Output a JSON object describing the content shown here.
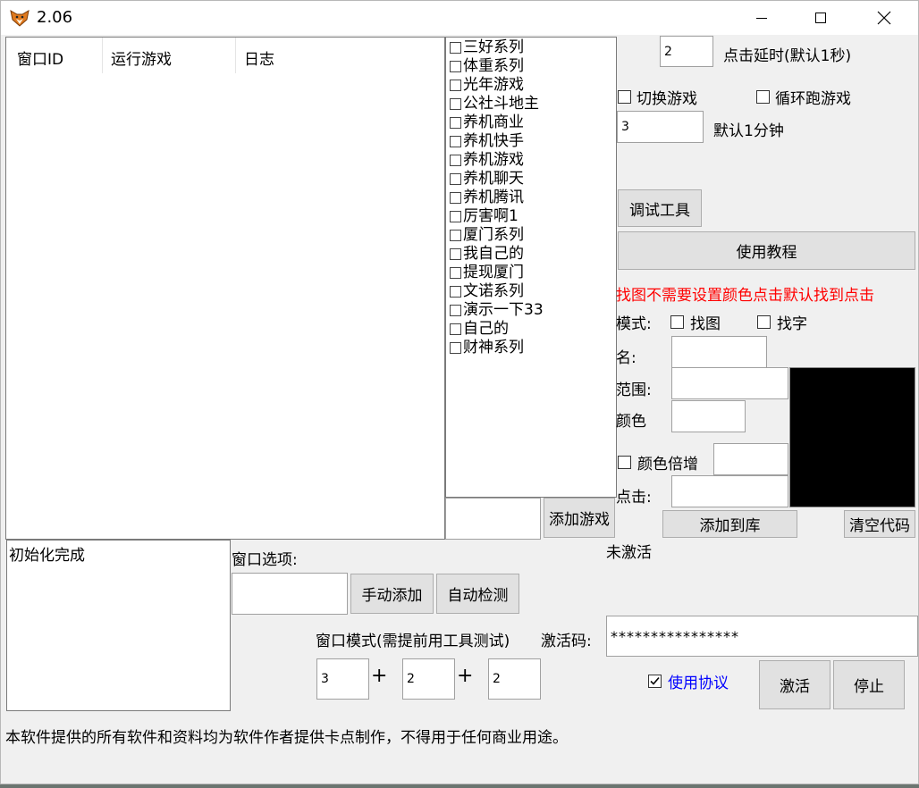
{
  "window": {
    "title": "2.06"
  },
  "list_columns": [
    "窗口ID",
    "运行游戏",
    "日志"
  ],
  "games": [
    "三好系列",
    "体重系列",
    "光年游戏",
    "公社斗地主",
    "养机商业",
    "养机快手",
    "养机游戏",
    "养机聊天",
    "养机腾讯",
    "厉害啊1",
    "厦门系列",
    "我自己的",
    "提现厦门",
    "文诺系列",
    "演示一下33",
    "自己的",
    "财神系列"
  ],
  "add_game_input": "",
  "add_game_button": "添加游戏",
  "click_delay": {
    "value": "2",
    "label": "点击延时(默认1秒)"
  },
  "switch_game_label": "切换游戏",
  "loop_game_label": "循环跑游戏",
  "minutes": {
    "value": "3",
    "label": "默认1分钟"
  },
  "debug_button": "调试工具",
  "tutorial_button": "使用教程",
  "hint_text": "找图不需要设置颜色点击默认找到点击",
  "mode": {
    "label": "模式:",
    "find_image": "找图",
    "find_text": "找字"
  },
  "fields": {
    "name_label": "名:",
    "range_label": "范围:",
    "color_label": "颜色",
    "color_multiply_label": "颜色倍增",
    "click_label": "点击:"
  },
  "add_to_library_button": "添加到库",
  "clear_code_button": "清空代码",
  "log_text": "初始化完成",
  "window_options_label": "窗口选项:",
  "manual_add_button": "手动添加",
  "auto_detect_button": "自动检测",
  "window_mode_label": "窗口模式(需提前用工具测试)",
  "window_mode_values": [
    "3",
    "2",
    "2"
  ],
  "plus_sign": "+",
  "activation_status": "未激活",
  "activation_code": {
    "label": "激活码:",
    "value": "****************"
  },
  "agreement": {
    "label": "使用协议",
    "checked": true
  },
  "activate_button": "激活",
  "stop_button": "停止",
  "footer_text": "本软件提供的所有软件和资料均为软件作者提供卡点制作，不得用于任何商业用途。",
  "colors": {
    "hint": "#ff0000",
    "link": "#0000ff",
    "preview": "#000000"
  }
}
